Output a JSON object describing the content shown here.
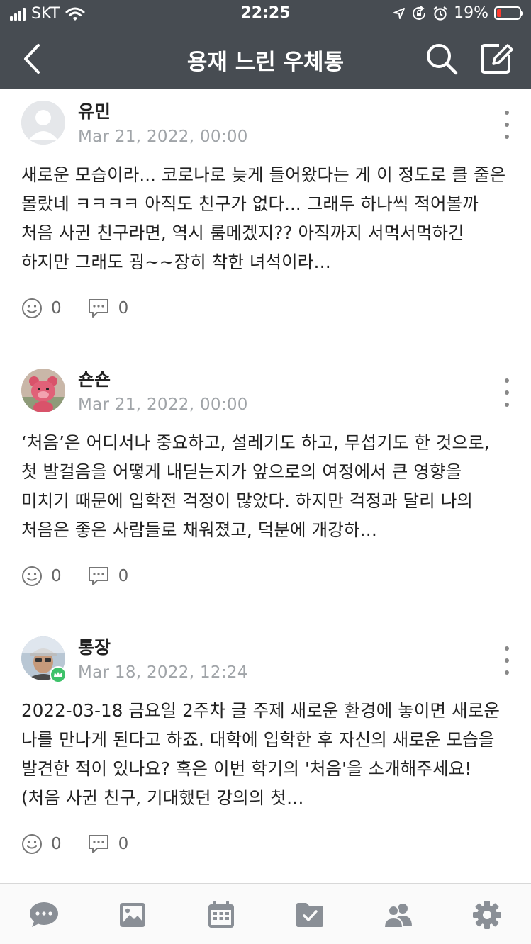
{
  "status_bar": {
    "carrier": "SKT",
    "time": "22:25",
    "battery_percent": "19%",
    "icons": [
      "signal-icon",
      "wifi-icon",
      "location-icon",
      "rotation-lock-icon",
      "alarm-icon",
      "battery-icon"
    ],
    "battery_level": 0.19,
    "battery_color": "#ff3b30"
  },
  "nav": {
    "title": "용재 느린 우체통",
    "background": "#474c52",
    "icons": [
      "back-icon",
      "search-icon",
      "compose-icon"
    ]
  },
  "posts": [
    {
      "author": "유민",
      "date": "Mar 21, 2022, 00:00",
      "avatar": "default-avatar-icon",
      "body": "새로운 모습이라... 코로나로 늦게 들어왔다는 게 이 정도로 클 줄은 몰랐네 ㅋㅋㅋㅋ 아직도 친구가 없다... 그래두 하나씩 적어볼까 처음 사귄 친구라면, 역시 룸메겠지?? 아직까지 서먹서먹하긴 하지만 그래도 굉~~장히 착한 녀석이라…",
      "likes": "0",
      "comments": "0"
    },
    {
      "author": "숀숀",
      "date": "Mar 21, 2022, 00:00",
      "avatar": "pink-bear-avatar",
      "body": "‘처음’은 어디서나 중요하고, 설레기도 하고, 무섭기도 한 것으로, 첫 발걸음을 어떻게 내딛는지가 앞으로의 여정에서 큰 영향을 미치기 때문에 입학전 걱정이 많았다. 하지만 걱정과 달리 나의 처음은 좋은 사람들로 채워졌고, 덕분에 개강하…",
      "likes": "0",
      "comments": "0"
    },
    {
      "author": "통장",
      "date": "Mar 18, 2022, 12:24",
      "avatar": "man-with-cap-avatar",
      "badge": "crown-badge-icon",
      "body": "2022-03-18 금요일 2주차 글 주제 새로운 환경에 놓이면 새로운 나를 만나게 된다고 하죠. 대학에 입학한 후 자신의 새로운 모습을 발견한 적이 있나요? 혹은 이번 학기의 '처음'을 소개해주세요! (처음 사귄 친구, 기대했던 강의의 첫…",
      "likes": "0",
      "comments": "0"
    }
  ],
  "tab_bar": {
    "tabs": [
      "chat-icon",
      "photo-icon",
      "calendar-icon",
      "folder-check-icon",
      "members-icon",
      "settings-icon"
    ]
  }
}
